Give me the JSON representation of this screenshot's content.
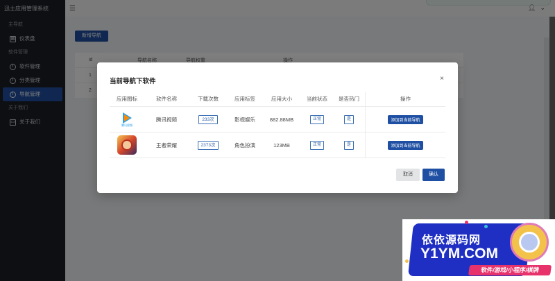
{
  "app": {
    "title": "迅士应用管理系统",
    "menu_toggle_icon": "menu-icon",
    "user_icon": "user-icon"
  },
  "sidebar": {
    "group_main": "主导航",
    "dashboard": "仪表盘",
    "group_software": "软件管理",
    "items": [
      {
        "label": "软件管理",
        "icon": "info-icon"
      },
      {
        "label": "分类管理",
        "icon": "info-icon"
      },
      {
        "label": "导航管理",
        "icon": "info-icon",
        "active": true
      }
    ],
    "group_about": "关于我们",
    "about": "关于我们"
  },
  "background": {
    "add_button": "新增导航",
    "columns": [
      "id",
      "导航名称",
      "导航权重",
      "",
      "操作"
    ],
    "rows": [
      [
        "1"
      ],
      [
        "2"
      ]
    ]
  },
  "modal": {
    "title": "当前导航下软件",
    "close": "×",
    "columns": [
      "应用图标",
      "软件名称",
      "下载次数",
      "应用标签",
      "应用大小",
      "当前状态",
      "是否热门",
      "操作"
    ],
    "rows": [
      {
        "icon": "tencent-video-app-icon",
        "icon_caption": "腾讯视频",
        "name": "腾讯视频",
        "downloads": "233次",
        "tag": "影视娱乐",
        "size": "882.88MB",
        "status": "正常",
        "hot": "是",
        "action": "添加到当前导航"
      },
      {
        "icon": "honor-of-kings-app-icon",
        "icon_caption": "",
        "name": "王者荣耀",
        "downloads": "2373次",
        "tag": "角色扮演",
        "size": "123MB",
        "status": "正常",
        "hot": "是",
        "action": "添加到当前导航"
      }
    ],
    "cancel": "取消",
    "confirm": "确认"
  },
  "watermark": {
    "line1": "依依源码网",
    "line2": "Y1YM.COM",
    "line3": "软件/游戏/小程序/棋牌"
  },
  "colors": {
    "primary": "#1e4fa3",
    "sidebar_bg": "#1c1f24",
    "overlay": "rgba(0,0,0,0.5)"
  }
}
